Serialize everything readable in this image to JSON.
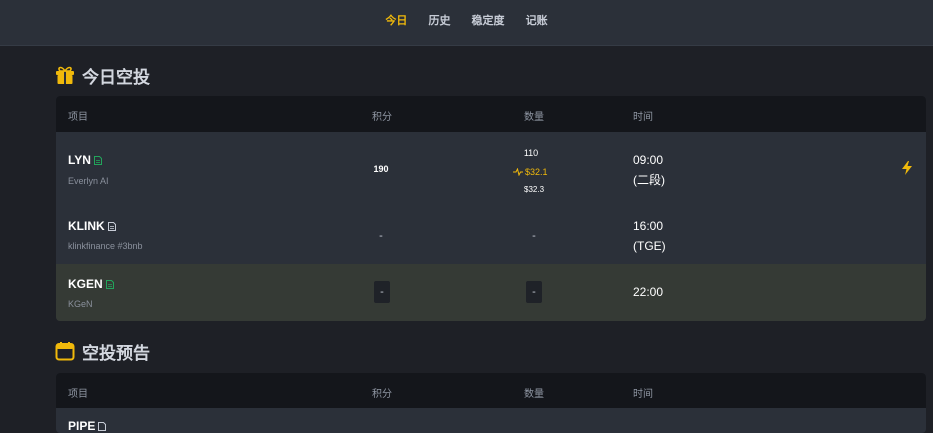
{
  "nav": {
    "items": [
      "今日",
      "历史",
      "稳定度",
      "记账"
    ],
    "active_index": 0
  },
  "today": {
    "title": "今日空投",
    "icon": "gift-icon",
    "headers": {
      "project": "项目",
      "points": "积分",
      "quantity": "数量",
      "time": "时间"
    },
    "rows": [
      {
        "symbol": "LYN",
        "name": "Everlyn AI",
        "points": "190",
        "quantity": "110",
        "price_main": "$32.1",
        "price_sub": "$32.3",
        "time_line1": "09:00",
        "time_line2": "(二段)",
        "doc_icon_color": "#22a55b",
        "action_icon": "lightning-icon"
      },
      {
        "symbol": "KLINK",
        "name": "klinkfinance #3bnb",
        "points": "-",
        "quantity": "-",
        "time_line1": "16:00",
        "time_line2": "(TGE)",
        "doc_icon_color": "#c7ccd6"
      },
      {
        "symbol": "KGEN",
        "name": "KGeN",
        "points": "-",
        "quantity": "-",
        "time_line1": "22:00",
        "doc_icon_color": "#22a55b"
      }
    ]
  },
  "preview": {
    "title": "空投预告",
    "icon": "calendar-icon",
    "headers": {
      "project": "项目",
      "points": "积分",
      "quantity": "数量",
      "time": "时间"
    },
    "rows": [
      {
        "symbol": "PIPE"
      }
    ]
  },
  "colors": {
    "accent": "#f0b90b",
    "background": "#1e2026",
    "panel": "#2b3039",
    "header": "#14161b",
    "highlight_row": "#353a35"
  }
}
